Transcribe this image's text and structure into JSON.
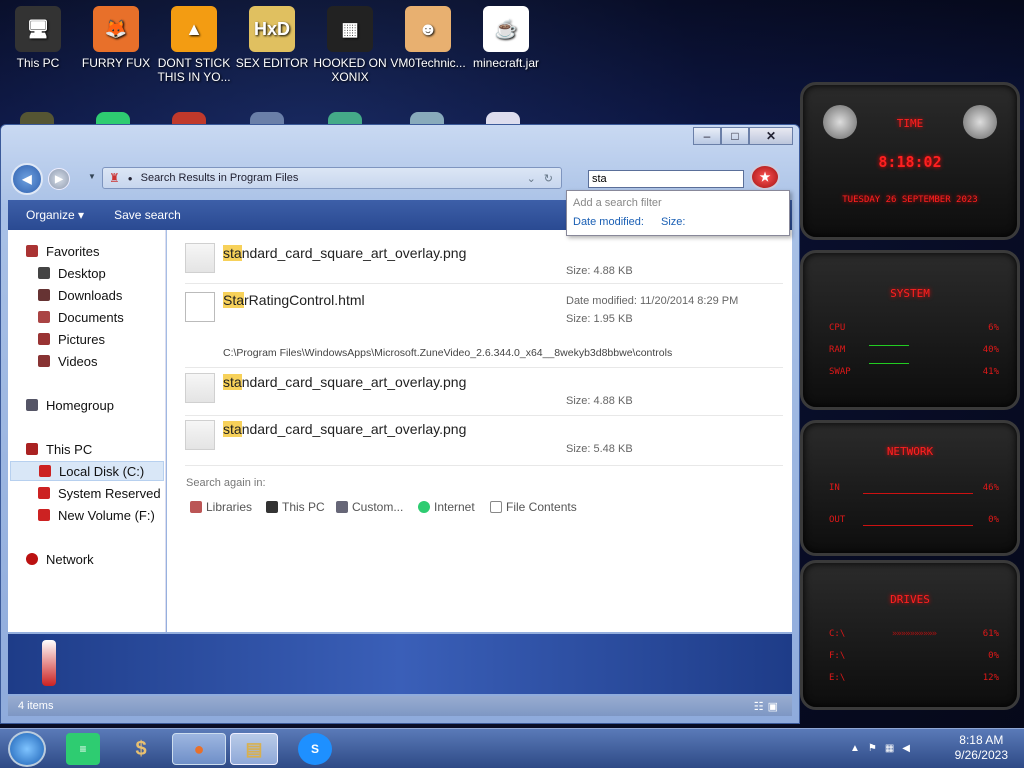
{
  "desktop_icons": [
    {
      "label": "This PC",
      "name": "this-pc-icon",
      "glyph": "🖥",
      "bg": "#333"
    },
    {
      "label": "FURRY FUX",
      "name": "firefox-icon",
      "glyph": "🦊",
      "bg": "#e8702a"
    },
    {
      "label": "DONT STICK THIS IN YO...",
      "name": "vlc-icon",
      "glyph": "▲",
      "bg": "#f39c12"
    },
    {
      "label": "SEX EDITOR",
      "name": "hxd-icon",
      "glyph": "HxD",
      "bg": "#e0c060"
    },
    {
      "label": "HOOKED ON XONIX",
      "name": "xonix-icon",
      "glyph": "▦",
      "bg": "#222"
    },
    {
      "label": "VM0Technic...",
      "name": "vmware-person-icon",
      "glyph": "☻",
      "bg": "#e8b070"
    },
    {
      "label": "minecraft.jar",
      "name": "java-icon",
      "glyph": "☕",
      "bg": "#fff"
    }
  ],
  "window": {
    "minimize": "–",
    "maximize": "□",
    "close": "✕"
  },
  "address": {
    "text": "Search Results in Program Files"
  },
  "search": {
    "value": "sta"
  },
  "popup": {
    "title": "Add a search filter",
    "filter1": "Date modified:",
    "filter2": "Size:"
  },
  "toolbar": {
    "organize": "Organize ▾",
    "save_search": "Save search"
  },
  "nav": {
    "favorites": "Favorites",
    "desktop": "Desktop",
    "downloads": "Downloads",
    "documents": "Documents",
    "pictures": "Pictures",
    "videos": "Videos",
    "homegroup": "Homegroup",
    "this_pc": "This PC",
    "local_disk": "Local Disk (C:)",
    "system_reserved": "System Reserved",
    "new_volume": "New Volume (F:)",
    "network": "Network"
  },
  "results": [
    {
      "hl": "sta",
      "rest": "ndard_card_square_art_overlay.png",
      "size": "Size: 4.88 KB"
    },
    {
      "hl": "Sta",
      "rest": "rRatingControl.html",
      "date": "Date modified: 11/20/2014 8:29 PM",
      "size": "Size: 1.95 KB",
      "path": "C:\\Program Files\\WindowsApps\\Microsoft.ZuneVideo_2.6.344.0_x64__8wekyb3d8bbwe\\controls"
    },
    {
      "hl": "sta",
      "rest": "ndard_card_square_art_overlay.png",
      "size": "Size: 4.88 KB"
    },
    {
      "hl": "sta",
      "rest": "ndard_card_square_art_overlay.png",
      "size": "Size: 5.48 KB"
    }
  ],
  "search_again": {
    "label": "Search again in:",
    "libraries": "Libraries",
    "this_pc": "This PC",
    "custom": "Custom...",
    "internet": "Internet",
    "file_contents": "File Contents"
  },
  "status": {
    "items": "4 items"
  },
  "gadgets": {
    "time_title": "TIME",
    "clock": "8:18:02",
    "date": "TUESDAY 26 SEPTEMBER 2023",
    "system_title": "SYSTEM",
    "cpu": "CPU",
    "cpu_val": "6%",
    "ram": "RAM",
    "ram_val": "40%",
    "swap": "SWAP",
    "swap_val": "41%",
    "network_title": "NETWORK",
    "in": "IN",
    "in_val": "46%",
    "out": "OUT",
    "out_val": "0%",
    "drives_title": "DRIVES",
    "c": "C:\\",
    "c_val": "61%",
    "f": "F:\\",
    "f_val": "0%",
    "e": "E:\\",
    "e_val": "12%"
  },
  "taskbar": {
    "time": "8:18 AM",
    "date": "9/26/2023"
  }
}
